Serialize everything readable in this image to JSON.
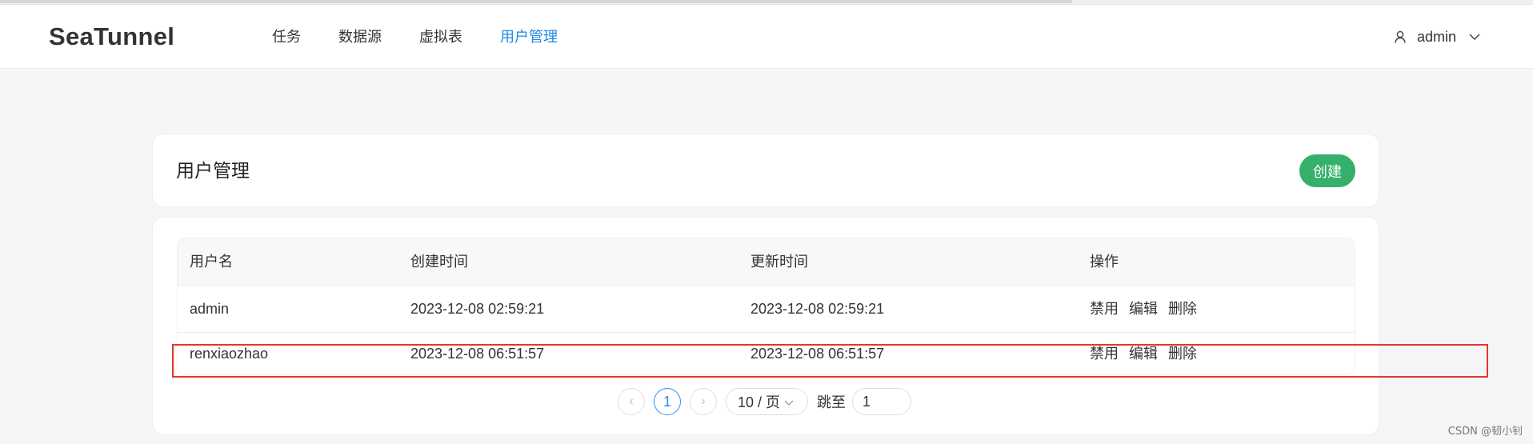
{
  "header": {
    "logo": "SeaTunnel",
    "nav": [
      "任务",
      "数据源",
      "虚拟表",
      "用户管理"
    ],
    "active_nav_index": 3,
    "user": "admin"
  },
  "page": {
    "title": "用户管理",
    "create_label": "创建"
  },
  "table": {
    "columns": [
      "用户名",
      "创建时间",
      "更新时间",
      "操作"
    ],
    "rows": [
      {
        "username": "admin",
        "created": "2023-12-08 02:59:21",
        "updated": "2023-12-08 02:59:21",
        "actions": [
          "禁用",
          "编辑",
          "删除"
        ]
      },
      {
        "username": "renxiaozhao",
        "created": "2023-12-08 06:51:57",
        "updated": "2023-12-08 06:51:57",
        "actions": [
          "禁用",
          "编辑",
          "删除"
        ]
      }
    ]
  },
  "pagination": {
    "prev": "‹",
    "next": "›",
    "current_page": "1",
    "page_size": "10 / 页",
    "jump_label": "跳至",
    "jump_value": "1"
  },
  "watermark": "CSDN @韧小钊",
  "colors": {
    "accent": "#1e88e5",
    "create_button": "#35b06a",
    "highlight": "#e8342b"
  },
  "icons": {
    "user": "user-icon",
    "dropdown": "chevron-down-icon"
  }
}
